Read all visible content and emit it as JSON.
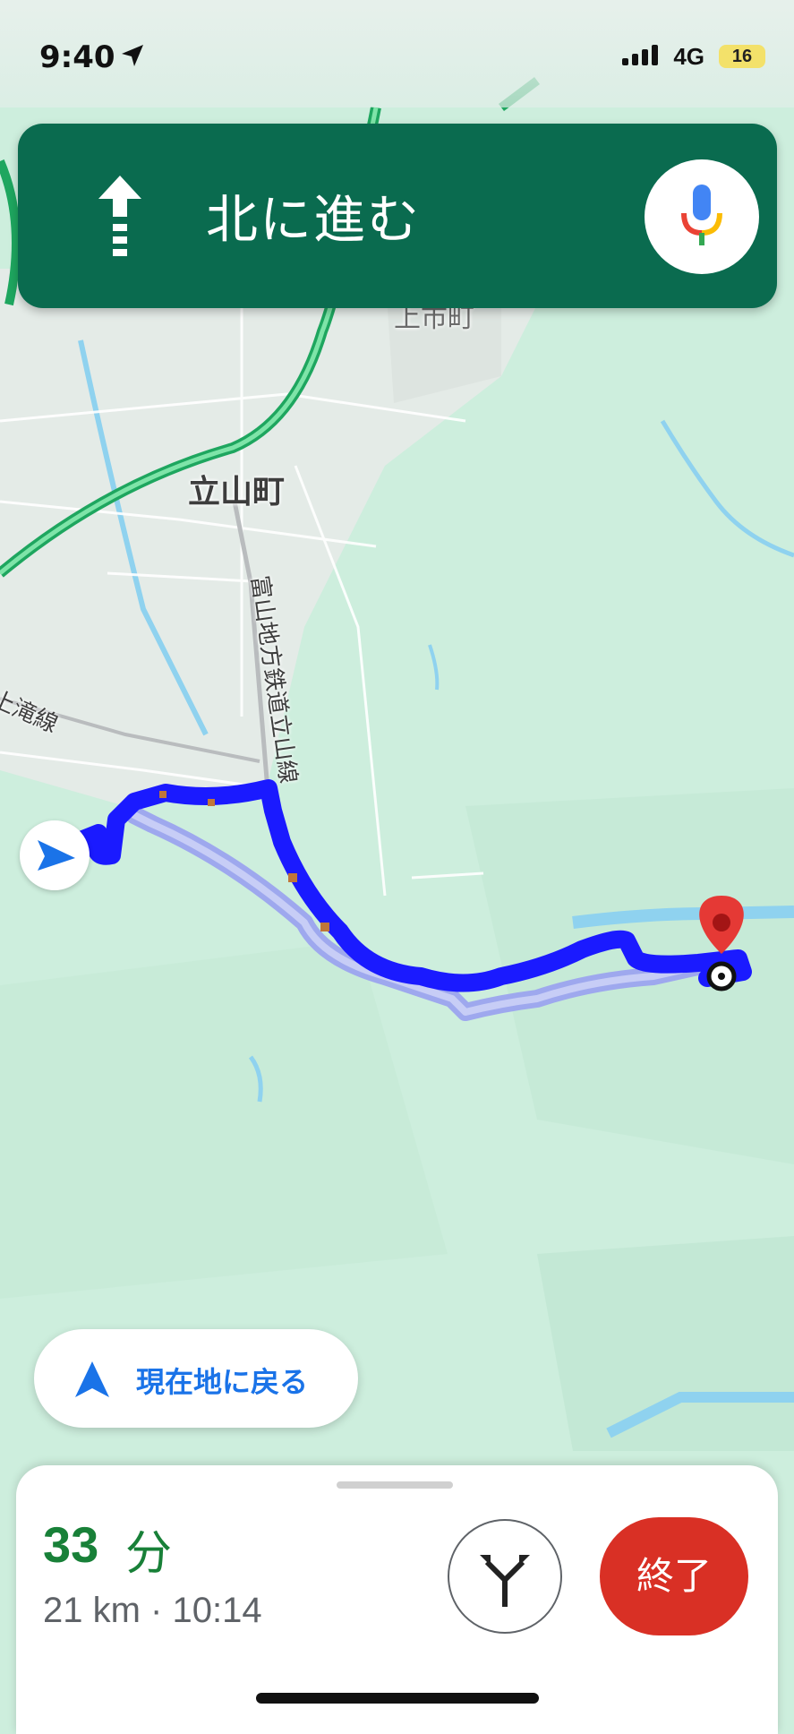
{
  "status_bar": {
    "time": "9:40",
    "network": "4G",
    "battery": "16"
  },
  "banner": {
    "instruction": "北に進む",
    "direction_icon": "straight-arrow-icon",
    "mic_icon": "microphone-icon"
  },
  "map": {
    "labels": {
      "town": "立山町",
      "partial_town": "上市町",
      "railway": "富山地方鉄道立山線",
      "line_left": "上滝線"
    },
    "colors": {
      "route": "#1a1aff",
      "route_alt": "#9ea8ee",
      "highway": "#20b46a",
      "destination": "#e53935"
    }
  },
  "recenter": {
    "label": "現在地に戻る"
  },
  "trip": {
    "eta_minutes": "33",
    "eta_unit": "分",
    "detail": "21 km · 10:14",
    "end_label": "終了",
    "alt_routes_icon": "alt-route-icon"
  }
}
